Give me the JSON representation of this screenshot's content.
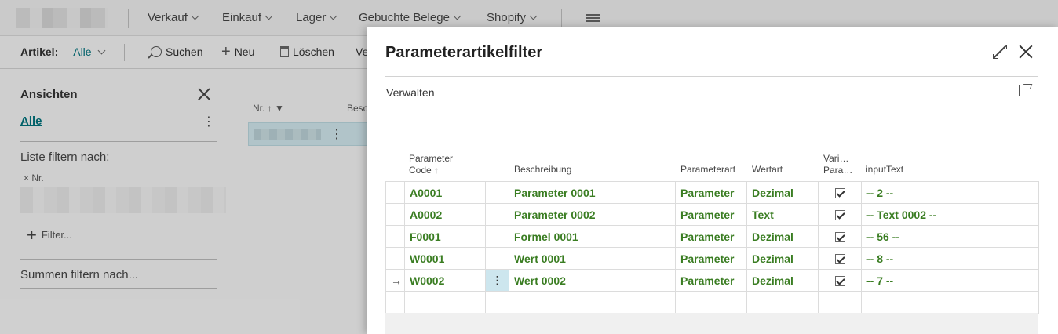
{
  "nav": {
    "menus": [
      "Verkauf",
      "Einkauf",
      "Lager",
      "Gebuchte Belege",
      "Shopify"
    ]
  },
  "actionbar": {
    "filter_label": "Artikel:",
    "filter_value": "Alle",
    "search": "Suchen",
    "new": "Neu",
    "delete": "Löschen",
    "partial": "Ve"
  },
  "sidebar": {
    "title": "Ansichten",
    "view_all": "Alle",
    "filter_list_by": "Liste filtern nach:",
    "filter_field": "× Nr.",
    "add_filter": "Filter...",
    "totals_filter": "Summen filtern nach..."
  },
  "list": {
    "col_no": "Nr. ↑",
    "col_desc": "Besch"
  },
  "dialog": {
    "title": "Parameterartikelfilter",
    "tab": "Verwalten",
    "columns": {
      "code_line1": "Parameter",
      "code_line2": "Code ↑",
      "description": "Beschreibung",
      "param_type": "Parameterart",
      "value_type": "Wertart",
      "variant_line1": "Vari…",
      "variant_line2": "Para…",
      "input_text": "inputText"
    },
    "rows": [
      {
        "code": "A0001",
        "description": "Parameter 0001",
        "param_type": "Parameter",
        "value_type": "Dezimal",
        "variant": true,
        "input_text": "-- 2 --"
      },
      {
        "code": "A0002",
        "description": "Parameter 0002",
        "param_type": "Parameter",
        "value_type": "Text",
        "variant": true,
        "input_text": "-- Text 0002 --"
      },
      {
        "code": "F0001",
        "description": "Formel 0001",
        "param_type": "Parameter",
        "value_type": "Dezimal",
        "variant": true,
        "input_text": "-- 56 --"
      },
      {
        "code": "W0001",
        "description": "Wert 0001",
        "param_type": "Parameter",
        "value_type": "Dezimal",
        "variant": true,
        "input_text": "-- 8 --"
      },
      {
        "code": "W0002",
        "description": "Wert 0002",
        "param_type": "Parameter",
        "value_type": "Dezimal",
        "variant": true,
        "input_text": "-- 7 --"
      }
    ],
    "current_row_indicator": "→",
    "row_menu_glyph": "⋮"
  },
  "colors": {
    "accent": "#00717b",
    "value_green": "#3a7d22",
    "selected_cell": "#cde6ee"
  }
}
